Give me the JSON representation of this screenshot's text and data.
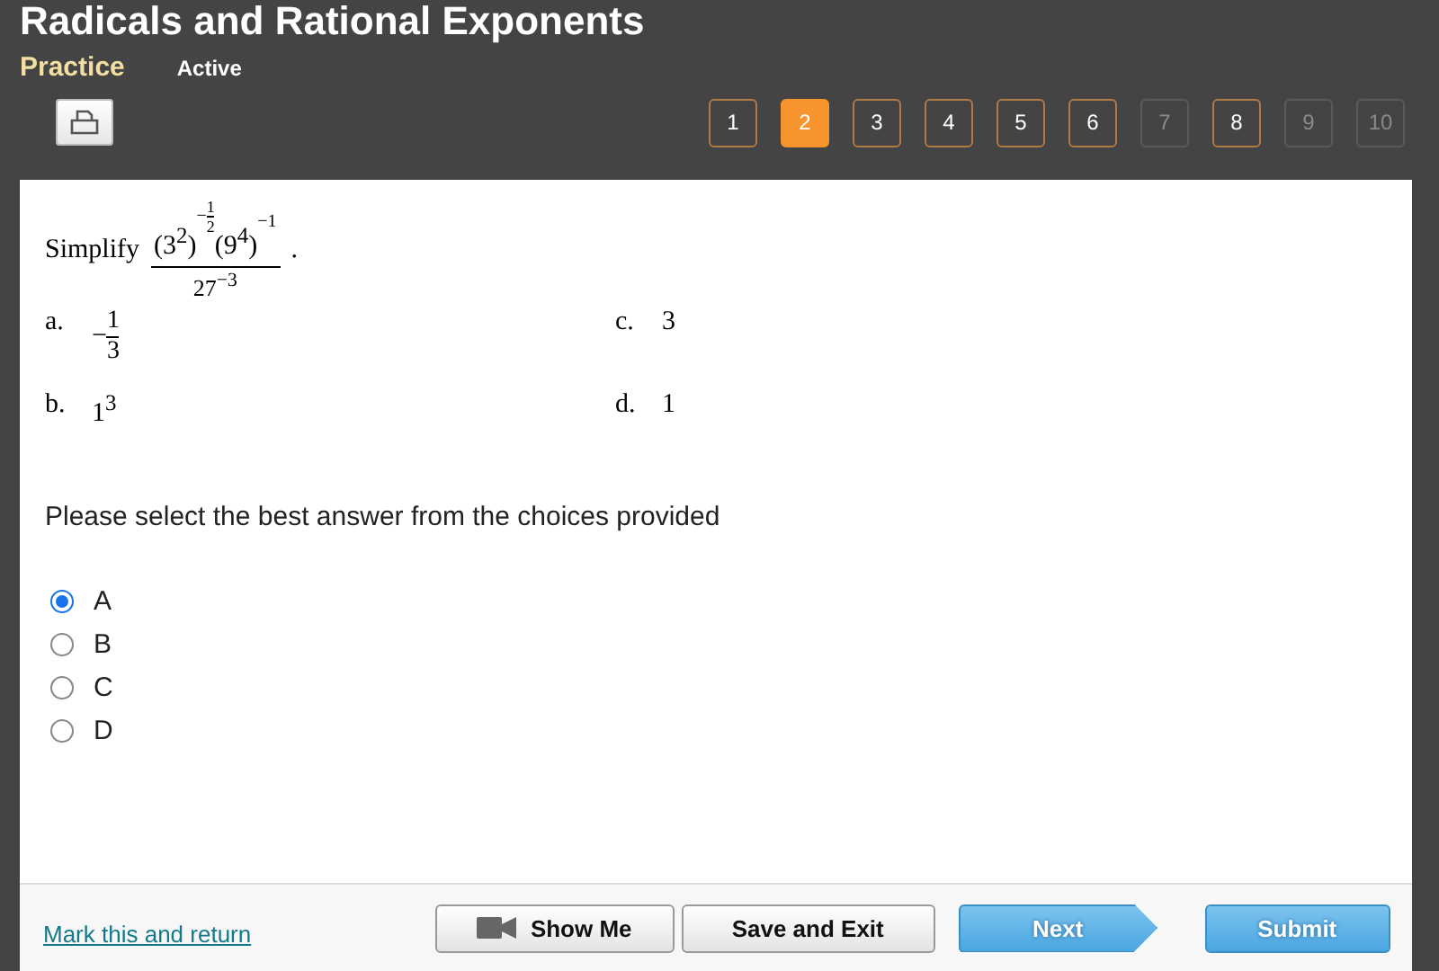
{
  "header": {
    "title": "Radicals and Rational Exponents",
    "mode": "Practice",
    "status": "Active"
  },
  "question_nav": [
    {
      "label": "1",
      "selected": false,
      "disabled": false
    },
    {
      "label": "2",
      "selected": true,
      "disabled": false
    },
    {
      "label": "3",
      "selected": false,
      "disabled": false
    },
    {
      "label": "4",
      "selected": false,
      "disabled": false
    },
    {
      "label": "5",
      "selected": false,
      "disabled": false
    },
    {
      "label": "6",
      "selected": false,
      "disabled": false
    },
    {
      "label": "7",
      "selected": false,
      "disabled": true
    },
    {
      "label": "8",
      "selected": false,
      "disabled": false
    },
    {
      "label": "9",
      "selected": false,
      "disabled": true
    },
    {
      "label": "10",
      "selected": false,
      "disabled": true
    }
  ],
  "question": {
    "prompt": "Simplify",
    "numerator": [
      {
        "kind": "fraction_exp",
        "base": "(3$^{2}$)",
        "exp_sign": "−",
        "exp_num": "1",
        "exp_den": "2"
      },
      {
        "kind": "plain_exp",
        "base": "(9$^{4}$)",
        "exp": "−1"
      }
    ],
    "denominator": "27$^{−3}$",
    "end": "."
  },
  "choices": [
    {
      "letter": "a.",
      "kind": "fraction",
      "sign": "−",
      "num": "1",
      "den": "3"
    },
    {
      "letter": "c.",
      "kind": "text",
      "text": "3"
    },
    {
      "letter": "b.",
      "kind": "text",
      "text": "1$^{3}$"
    },
    {
      "letter": "d.",
      "kind": "text",
      "text": "1"
    }
  ],
  "instruction": "Please select the best answer from the choices provided",
  "answers": [
    {
      "label": "A",
      "selected": true
    },
    {
      "label": "B",
      "selected": false
    },
    {
      "label": "C",
      "selected": false
    },
    {
      "label": "D",
      "selected": false
    }
  ],
  "footer": {
    "link": "Mark this and return",
    "buttons": [
      {
        "kind": "video",
        "label": "Show Me"
      },
      {
        "kind": "plain",
        "label": "Save and Exit"
      },
      {
        "kind": "next",
        "label": "Next"
      },
      {
        "kind": "primary",
        "label": "Submit"
      }
    ]
  }
}
